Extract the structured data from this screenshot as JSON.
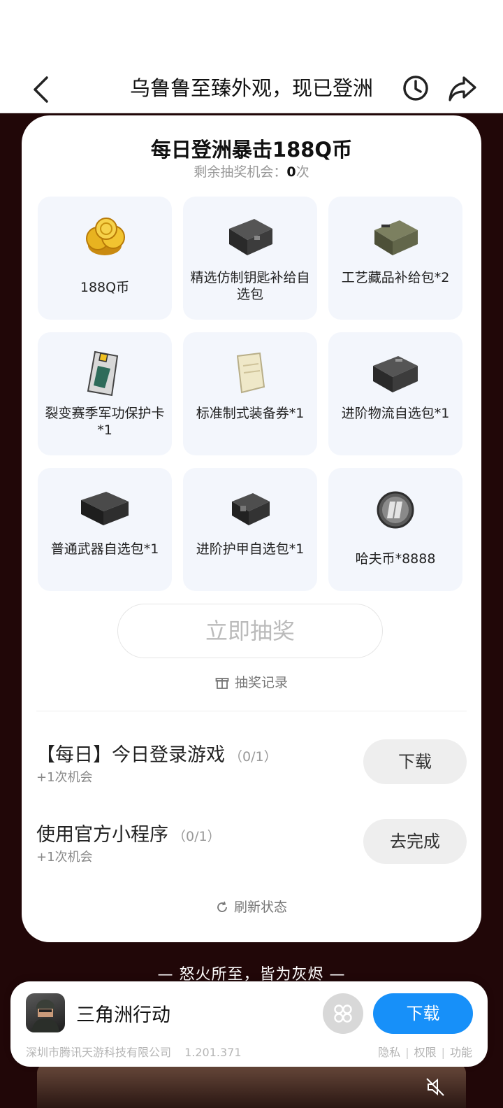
{
  "header": {
    "title": "乌鲁鲁至臻外观，现已登洲"
  },
  "lottery": {
    "title": "每日登洲暴击188Q币",
    "chances_label": "剩余抽奖机会：",
    "chances_count": "0",
    "chances_unit": "次",
    "prizes": [
      {
        "name": "188Q币",
        "icon": "qcoin-stack-icon"
      },
      {
        "name": "精选仿制钥匙补给自选包",
        "icon": "black-crate-icon"
      },
      {
        "name": "工艺藏品补给包*2",
        "icon": "olive-crate-icon"
      },
      {
        "name": "裂变赛季军功保护卡*1",
        "icon": "protection-card-icon"
      },
      {
        "name": "标准制式装备券*1",
        "icon": "voucher-icon"
      },
      {
        "name": "进阶物流自选包*1",
        "icon": "black-crate-icon"
      },
      {
        "name": "普通武器自选包*1",
        "icon": "weapon-case-icon"
      },
      {
        "name": "进阶护甲自选包*1",
        "icon": "armor-crate-icon"
      },
      {
        "name": "哈夫币*8888",
        "icon": "haf-coin-icon"
      }
    ],
    "draw_button": "立即抽奖",
    "records_link": "抽奖记录"
  },
  "tasks": [
    {
      "name": "【每日】今日登录游戏",
      "progress": "（0/1）",
      "reward": "+1次机会",
      "button": "下载"
    },
    {
      "name": "使用官方小程序",
      "progress": "（0/1）",
      "reward": "+1次机会",
      "button": "去完成"
    }
  ],
  "refresh_label": "刷新状态",
  "slogan": "— 怒火所至，皆为灰烬 —",
  "app_panel": {
    "name": "三角洲行动",
    "install_button": "下载",
    "developer": "深圳市腾讯天游科技有限公司",
    "version": "1.201.371",
    "links": [
      "隐私",
      "权限",
      "功能"
    ]
  },
  "colors": {
    "page_background": "#210708",
    "accent_blue": "#1790f9",
    "prize_tile": "#f3f6fc"
  }
}
